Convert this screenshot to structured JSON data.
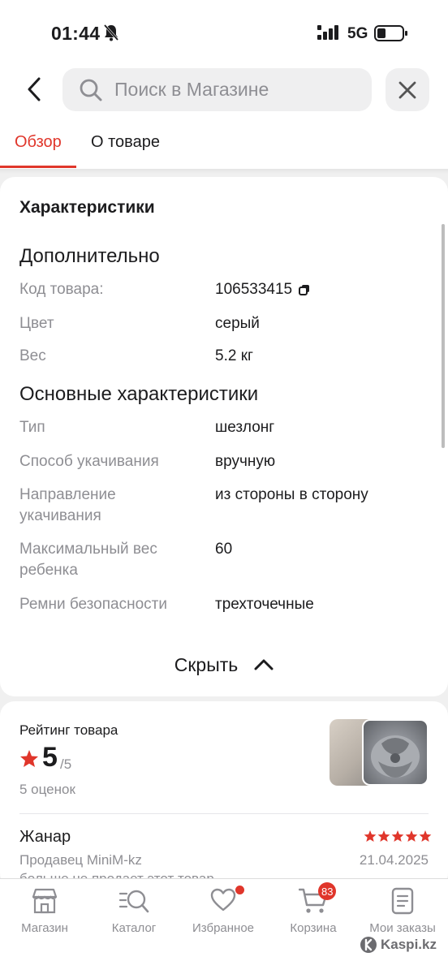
{
  "status_bar": {
    "time": "01:44",
    "network": "5G"
  },
  "search": {
    "placeholder": "Поиск в Магазине"
  },
  "tabs": [
    {
      "label": "Обзор",
      "active": true
    },
    {
      "label": "О товаре",
      "active": false
    }
  ],
  "characteristics": {
    "title": "Характеристики",
    "groups": [
      {
        "title": "Дополнительно",
        "rows": [
          {
            "label": "Код товара:",
            "value": "106533415"
          },
          {
            "label": "Цвет",
            "value": "серый"
          },
          {
            "label": "Вес",
            "value": "5.2 кг"
          }
        ]
      },
      {
        "title": "Основные характеристики",
        "rows": [
          {
            "label": "Тип",
            "value": "шезлонг"
          },
          {
            "label": "Способ укачивания",
            "value": "вручную"
          },
          {
            "label": "Направление укачивания",
            "value": "из стороны в сторону"
          },
          {
            "label": "Максимальный вес ребенка",
            "value": "60"
          },
          {
            "label": "Ремни безопасности",
            "value": "трехточечные"
          }
        ]
      }
    ],
    "hide_label": "Скрыть"
  },
  "rating": {
    "title": "Рейтинг товара",
    "score": "5",
    "max": "/5",
    "count": "5 оценок",
    "review": {
      "author": "Жанар",
      "stars": 5,
      "seller": "Продавец MiniM-kz",
      "date": "21.04.2025",
      "note": "больше не продает этот товар"
    }
  },
  "bottom_nav": [
    {
      "label": "Магазин",
      "icon": "shop-icon"
    },
    {
      "label": "Каталог",
      "icon": "catalog-icon"
    },
    {
      "label": "Избранное",
      "icon": "heart-icon"
    },
    {
      "label": "Корзина",
      "icon": "cart-icon",
      "badge": "83"
    },
    {
      "label": "Мои заказы",
      "icon": "orders-icon"
    }
  ],
  "watermark": "Kaspi.kz",
  "colors": {
    "accent": "#e0362b",
    "muted_text": "#8e8e93"
  }
}
